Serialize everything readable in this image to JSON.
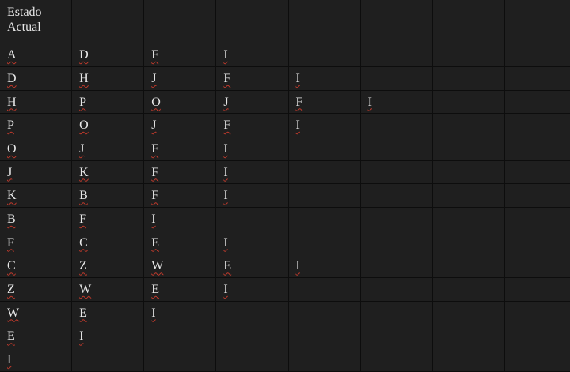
{
  "header": [
    "Estado Actual",
    "",
    "",
    "",
    "",
    "",
    "",
    ""
  ],
  "rows": [
    [
      "A",
      "D",
      "F",
      "I",
      "",
      "",
      "",
      ""
    ],
    [
      "D",
      "H",
      "J",
      "F",
      "I",
      "",
      "",
      ""
    ],
    [
      "H",
      "P",
      "O",
      "J",
      "F",
      "I",
      "",
      ""
    ],
    [
      "P",
      "O",
      "J",
      "F",
      "I",
      "",
      "",
      ""
    ],
    [
      "O",
      "J",
      "F",
      "I",
      "",
      "",
      "",
      ""
    ],
    [
      "J",
      "K",
      "F",
      "I",
      "",
      "",
      "",
      ""
    ],
    [
      "K",
      "B",
      "F",
      "I",
      "",
      "",
      "",
      ""
    ],
    [
      "B",
      "F",
      "I",
      "",
      "",
      "",
      "",
      ""
    ],
    [
      "F",
      "C",
      "E",
      "I",
      "",
      "",
      "",
      ""
    ],
    [
      "C",
      "Z",
      "W",
      "E",
      "I",
      "",
      "",
      ""
    ],
    [
      "Z",
      "W",
      "E",
      "I",
      "",
      "",
      "",
      ""
    ],
    [
      "W",
      "E",
      "I",
      "",
      "",
      "",
      "",
      ""
    ],
    [
      "E",
      "I",
      "",
      "",
      "",
      "",
      "",
      ""
    ],
    [
      "I",
      "",
      "",
      "",
      "",
      "",
      "",
      ""
    ]
  ]
}
